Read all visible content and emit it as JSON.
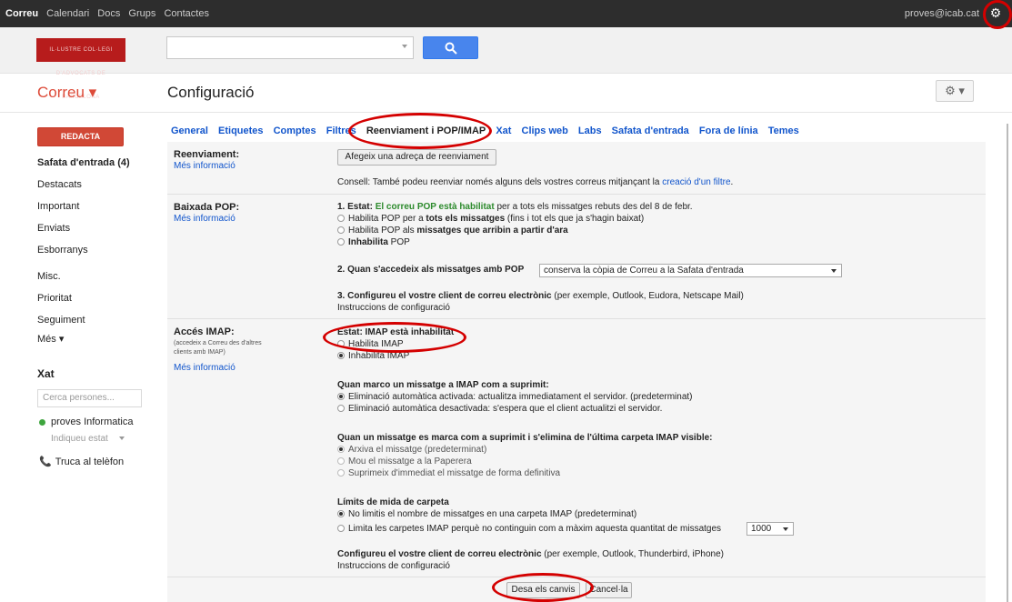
{
  "topbar": {
    "apps": [
      "Correu",
      "Calendari",
      "Docs",
      "Grups",
      "Contactes"
    ],
    "user": "proves@icab.cat"
  },
  "header": {
    "logo_text": "IL·LUSTRE COL·LEGI D'ADVOCATS DE BARCELONA",
    "search_placeholder": ""
  },
  "toolbar": {
    "app_name": "Correu ▾",
    "page_title": "Configuració",
    "settings_glyph": "⚙ ▾"
  },
  "nav": {
    "compose": "REDACTA",
    "items": [
      "Safata d'entrada (4)",
      "Destacats",
      "Important",
      "Enviats",
      "Esborranys",
      "Misc.",
      "Prioritat",
      "Seguiment",
      "Més ▾"
    ],
    "chat_title": "Xat",
    "people_search_placeholder": "Cerca persones...",
    "contact_name": "proves Informatica",
    "status": "Indiqueu estat",
    "call": "Truca al telèfon"
  },
  "tabs": [
    "General",
    "Etiquetes",
    "Comptes",
    "Filtres",
    "Reenviament i POP/IMAP",
    "Xat",
    "Clips web",
    "Labs",
    "Safata d'entrada",
    "Fora de línia",
    "Temes"
  ],
  "active_tab": "Reenviament i POP/IMAP",
  "forwarding": {
    "label": "Reenviament:",
    "more_info": "Més informació",
    "add_button": "Afegeix una adreça de reenviament",
    "tip_prefix": "Consell: També podeu reenviar només alguns dels vostres correus mitjançant la ",
    "tip_link": "creació d'un filtre",
    "tip_suffix": "."
  },
  "pop": {
    "label": "Baixada POP:",
    "more_info": "Més informació",
    "status_num": "1. Estat: ",
    "status_green": "El correu POP està habilitat",
    "status_rest": " per a tots els missatges rebuts des del 8 de febr.",
    "opt1_a": "Habilita POP per a ",
    "opt1_b": "tots els missatges",
    "opt1_c": " (fins i tot els que ja s'hagin baixat)",
    "opt2_a": "Habilita POP als ",
    "opt2_b": "missatges que arribin a partir d'ara",
    "opt3_b": "Inhabilita",
    "opt3_c": " POP",
    "q2": "2. Quan s'accedeix als missatges amb POP",
    "q2_select": "conserva la còpia de Correu a la Safata d'entrada",
    "q3_b": "3. Configureu el vostre client de correu electrònic",
    "q3_rest": " (per exemple, Outlook, Eudora, Netscape Mail)",
    "q3_link": "Instruccions de configuració"
  },
  "imap": {
    "label": "Accés IMAP:",
    "note": "(accedeix a Correu des d'altres clients amb IMAP)",
    "more_info": "Més informació",
    "status": "Estat: IMAP està inhabilitat",
    "enable": "Habilita IMAP",
    "disable": "Inhabilita IMAP",
    "del_title": "Quan marco un missatge a IMAP com a suprimit:",
    "del_opt1": "Eliminació automàtica activada: actualitza immediatament el servidor. (predeterminat)",
    "del_opt2": "Eliminació automàtica desactivada: s'espera que el client actualitzi el servidor.",
    "exp_title": "Quan un missatge es marca com a suprimit i s'elimina de l'última carpeta IMAP visible:",
    "exp_opt1": "Arxiva el missatge (predeterminat)",
    "exp_opt2": "Mou el missatge a la Paperera",
    "exp_opt3": "Suprimeix d'immediat el missatge de forma definitiva",
    "lim_title": "Límits de mida de carpeta",
    "lim_opt1": "No limitis el nombre de missatges en una carpeta IMAP (predeterminat)",
    "lim_opt2": "Limita les carpetes IMAP perquè no continguin com a màxim aquesta quantitat de missatges",
    "lim_select": "1000",
    "cfg_b": "Configureu el vostre client de correu electrònic",
    "cfg_rest": " (per exemple, Outlook, Thunderbird, iPhone)",
    "cfg_link": "Instruccions de configuració"
  },
  "footer": {
    "save": "Desa els canvis",
    "cancel": "Cancel·la"
  },
  "colors": {
    "accent_red": "#dd4b39",
    "compose_red": "#d14836",
    "link_blue": "#1155cc",
    "search_blue": "#4885ed",
    "annotation_red": "#d40000"
  }
}
